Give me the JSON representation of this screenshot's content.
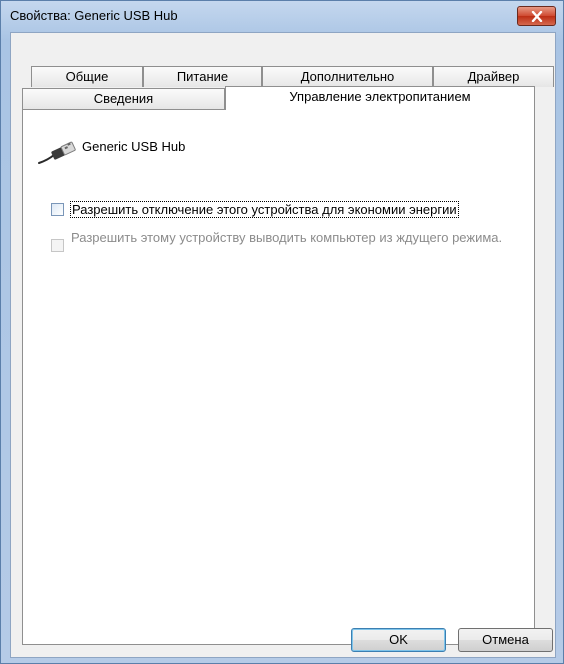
{
  "window": {
    "title": "Свойства: Generic USB Hub"
  },
  "tabs_row1": [
    "Общие",
    "Питание",
    "Дополнительно",
    "Драйвер"
  ],
  "tabs_row2": [
    "Сведения",
    "Управление электропитанием"
  ],
  "active_tab": "Управление электропитанием",
  "device": {
    "name": "Generic USB Hub",
    "icon": "usb-plug-icon"
  },
  "options": {
    "allow_turn_off": {
      "label": "Разрешить отключение этого устройства для экономии энергии",
      "checked": false,
      "enabled": true
    },
    "allow_wake": {
      "label": "Разрешить этому устройству выводить компьютер из ждущего режима.",
      "checked": false,
      "enabled": false
    }
  },
  "buttons": {
    "ok": "OK",
    "cancel": "Отмена"
  }
}
